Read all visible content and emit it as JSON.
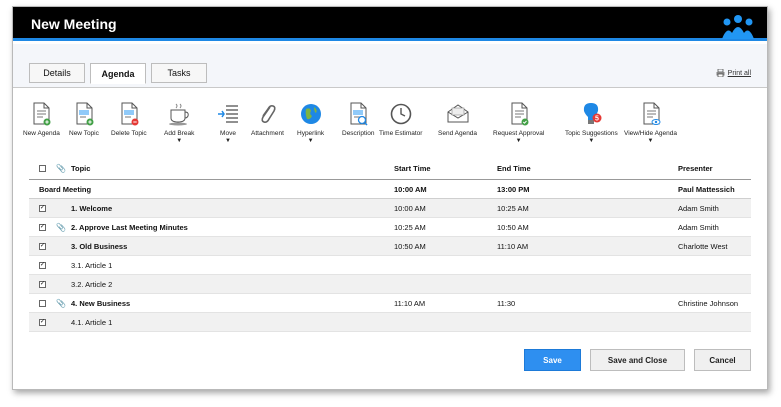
{
  "window": {
    "title": "New Meeting"
  },
  "tabs": [
    {
      "label": "Details"
    },
    {
      "label": "Agenda"
    },
    {
      "label": "Tasks"
    }
  ],
  "print_all": "Print all",
  "toolbar": [
    {
      "label": "New Agenda",
      "icon": "new-agenda-icon",
      "dropdown": false
    },
    {
      "label": "New Topic",
      "icon": "new-topic-icon",
      "dropdown": false
    },
    {
      "label": "Delete Topic",
      "icon": "delete-topic-icon",
      "dropdown": false
    },
    {
      "label": "Add Break",
      "icon": "coffee-cup-icon",
      "dropdown": true
    },
    {
      "label": "Move",
      "icon": "move-icon",
      "dropdown": true
    },
    {
      "label": "Attachment",
      "icon": "paperclip-icon",
      "dropdown": false
    },
    {
      "label": "Hyperlink",
      "icon": "globe-icon",
      "dropdown": true
    },
    {
      "label": "Description",
      "icon": "description-icon",
      "dropdown": false
    },
    {
      "label": "Time Estimator",
      "icon": "clock-icon",
      "dropdown": false
    },
    {
      "label": "Send Agenda",
      "icon": "envelope-icon",
      "dropdown": false
    },
    {
      "label": "Request Approval",
      "icon": "approval-icon",
      "dropdown": true
    },
    {
      "label": "Topic Suggestions",
      "icon": "lightbulb-icon",
      "dropdown": true,
      "badge": "5"
    },
    {
      "label": "View/Hide Agenda",
      "icon": "view-agenda-icon",
      "dropdown": true
    }
  ],
  "grid": {
    "headers": {
      "topic": "Topic",
      "start": "Start Time",
      "end": "End Time",
      "presenter": "Presenter"
    },
    "group": {
      "name": "Board Meeting",
      "start": "10:00 AM",
      "end": "13:00 PM",
      "presenter": "Paul Mattessich"
    },
    "rows": [
      {
        "checked": true,
        "attachment": false,
        "topic": "1. Welcome",
        "bold": true,
        "start": "10:00 AM",
        "end": "10:25 AM",
        "presenter": "Adam Smith"
      },
      {
        "checked": true,
        "attachment": true,
        "topic": "2. Approve Last Meeting Minutes",
        "bold": true,
        "start": "10:25 AM",
        "end": "10:50 AM",
        "presenter": "Adam Smith"
      },
      {
        "checked": true,
        "attachment": false,
        "topic": "3. Old Business",
        "bold": true,
        "start": "10:50 AM",
        "end": "11:10 AM",
        "presenter": "Charlotte West"
      },
      {
        "checked": true,
        "attachment": false,
        "topic": "3.1. Article 1",
        "bold": false,
        "start": "",
        "end": "",
        "presenter": ""
      },
      {
        "checked": true,
        "attachment": false,
        "topic": "3.2. Article 2",
        "bold": false,
        "start": "",
        "end": "",
        "presenter": ""
      },
      {
        "checked": false,
        "attachment": true,
        "topic": "4. New Business",
        "bold": true,
        "start": "11:10 AM",
        "end": "11:30",
        "presenter": "Christine Johnson"
      },
      {
        "checked": true,
        "attachment": false,
        "topic": "4.1. Article 1",
        "bold": false,
        "start": "",
        "end": "",
        "presenter": ""
      }
    ]
  },
  "buttons": {
    "save": "Save",
    "save_close": "Save and Close",
    "cancel": "Cancel"
  },
  "colors": {
    "accent": "#2e8ff0",
    "titlebar": "#000000",
    "badge": "#e53935"
  }
}
